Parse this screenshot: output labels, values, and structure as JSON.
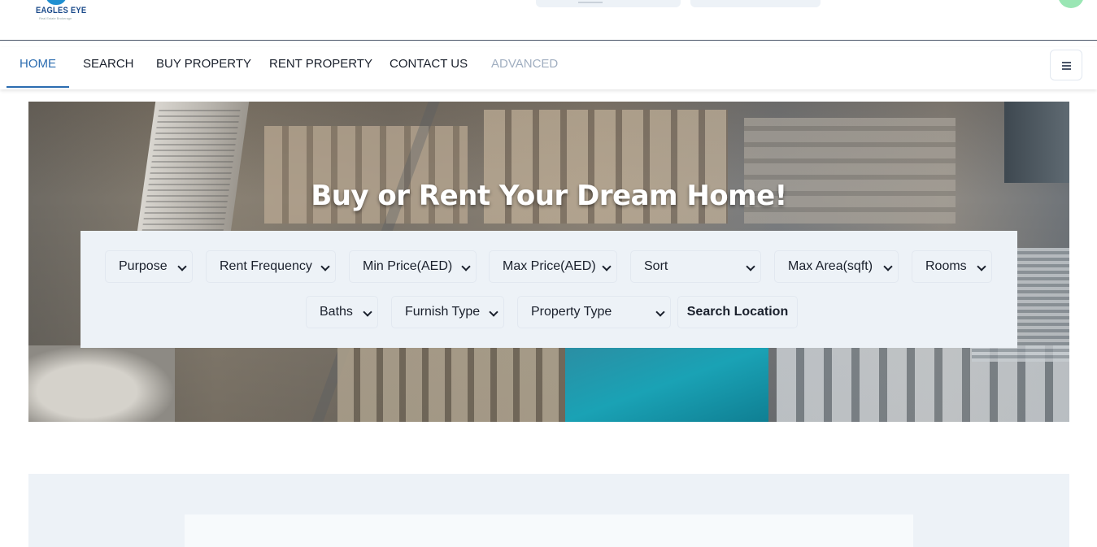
{
  "header": {
    "logo_text_1": "EAGLES",
    "logo_text_2": "EYE",
    "logo_tagline": "Real Estate Brokerage"
  },
  "nav": {
    "items": [
      {
        "label": "HOME",
        "state": "active"
      },
      {
        "label": "SEARCH",
        "state": "normal"
      },
      {
        "label": "BUY PROPERTY",
        "state": "normal"
      },
      {
        "label": "RENT PROPERTY",
        "state": "normal"
      },
      {
        "label": "CONTACT US",
        "state": "normal"
      },
      {
        "label": "ADVANCED",
        "state": "disabled"
      }
    ],
    "menu_icon": "hamburger-icon"
  },
  "hero": {
    "title": "Buy or Rent Your Dream Home!"
  },
  "filters": {
    "purpose": "Purpose",
    "rent_frequency": "Rent Frequency",
    "min_price": "Min Price(AED)",
    "max_price": "Max Price(AED)",
    "sort": "Sort",
    "max_area": "Max Area(sqft)",
    "rooms": "Rooms",
    "baths": "Baths",
    "furnish_type": "Furnish Type",
    "property_type": "Property Type",
    "search_location": "Search Location"
  },
  "colors": {
    "accent": "#2b6cb0",
    "panel": "#edf2f7",
    "avatar": "#9ae6b4"
  }
}
